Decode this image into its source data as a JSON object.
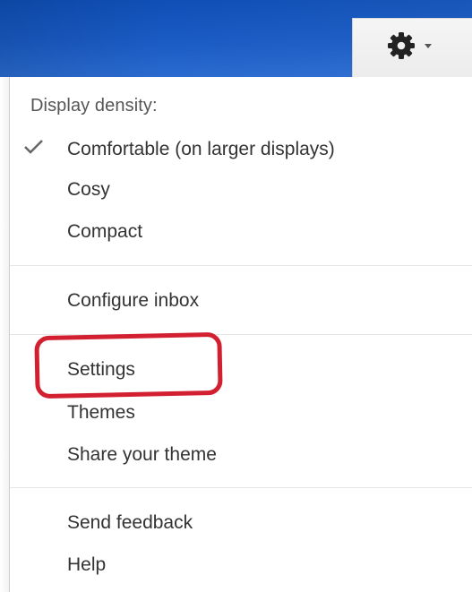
{
  "toolbar": {
    "settings_button_icon": "gear-icon",
    "dropdown_icon": "chevron-down-icon"
  },
  "menu": {
    "density_label": "Display density:",
    "density_options": [
      {
        "label": "Comfortable (on larger displays)",
        "selected": true
      },
      {
        "label": "Cosy",
        "selected": false
      },
      {
        "label": "Compact",
        "selected": false
      }
    ],
    "configure_inbox": "Configure inbox",
    "settings": "Settings",
    "themes": "Themes",
    "share_theme": "Share your theme",
    "send_feedback": "Send feedback",
    "help": "Help"
  },
  "colors": {
    "header_blue": "#1a5bc4",
    "annotation_red": "#d32030"
  },
  "annotation": {
    "shape": "rounded-rectangle",
    "target": "Settings"
  }
}
